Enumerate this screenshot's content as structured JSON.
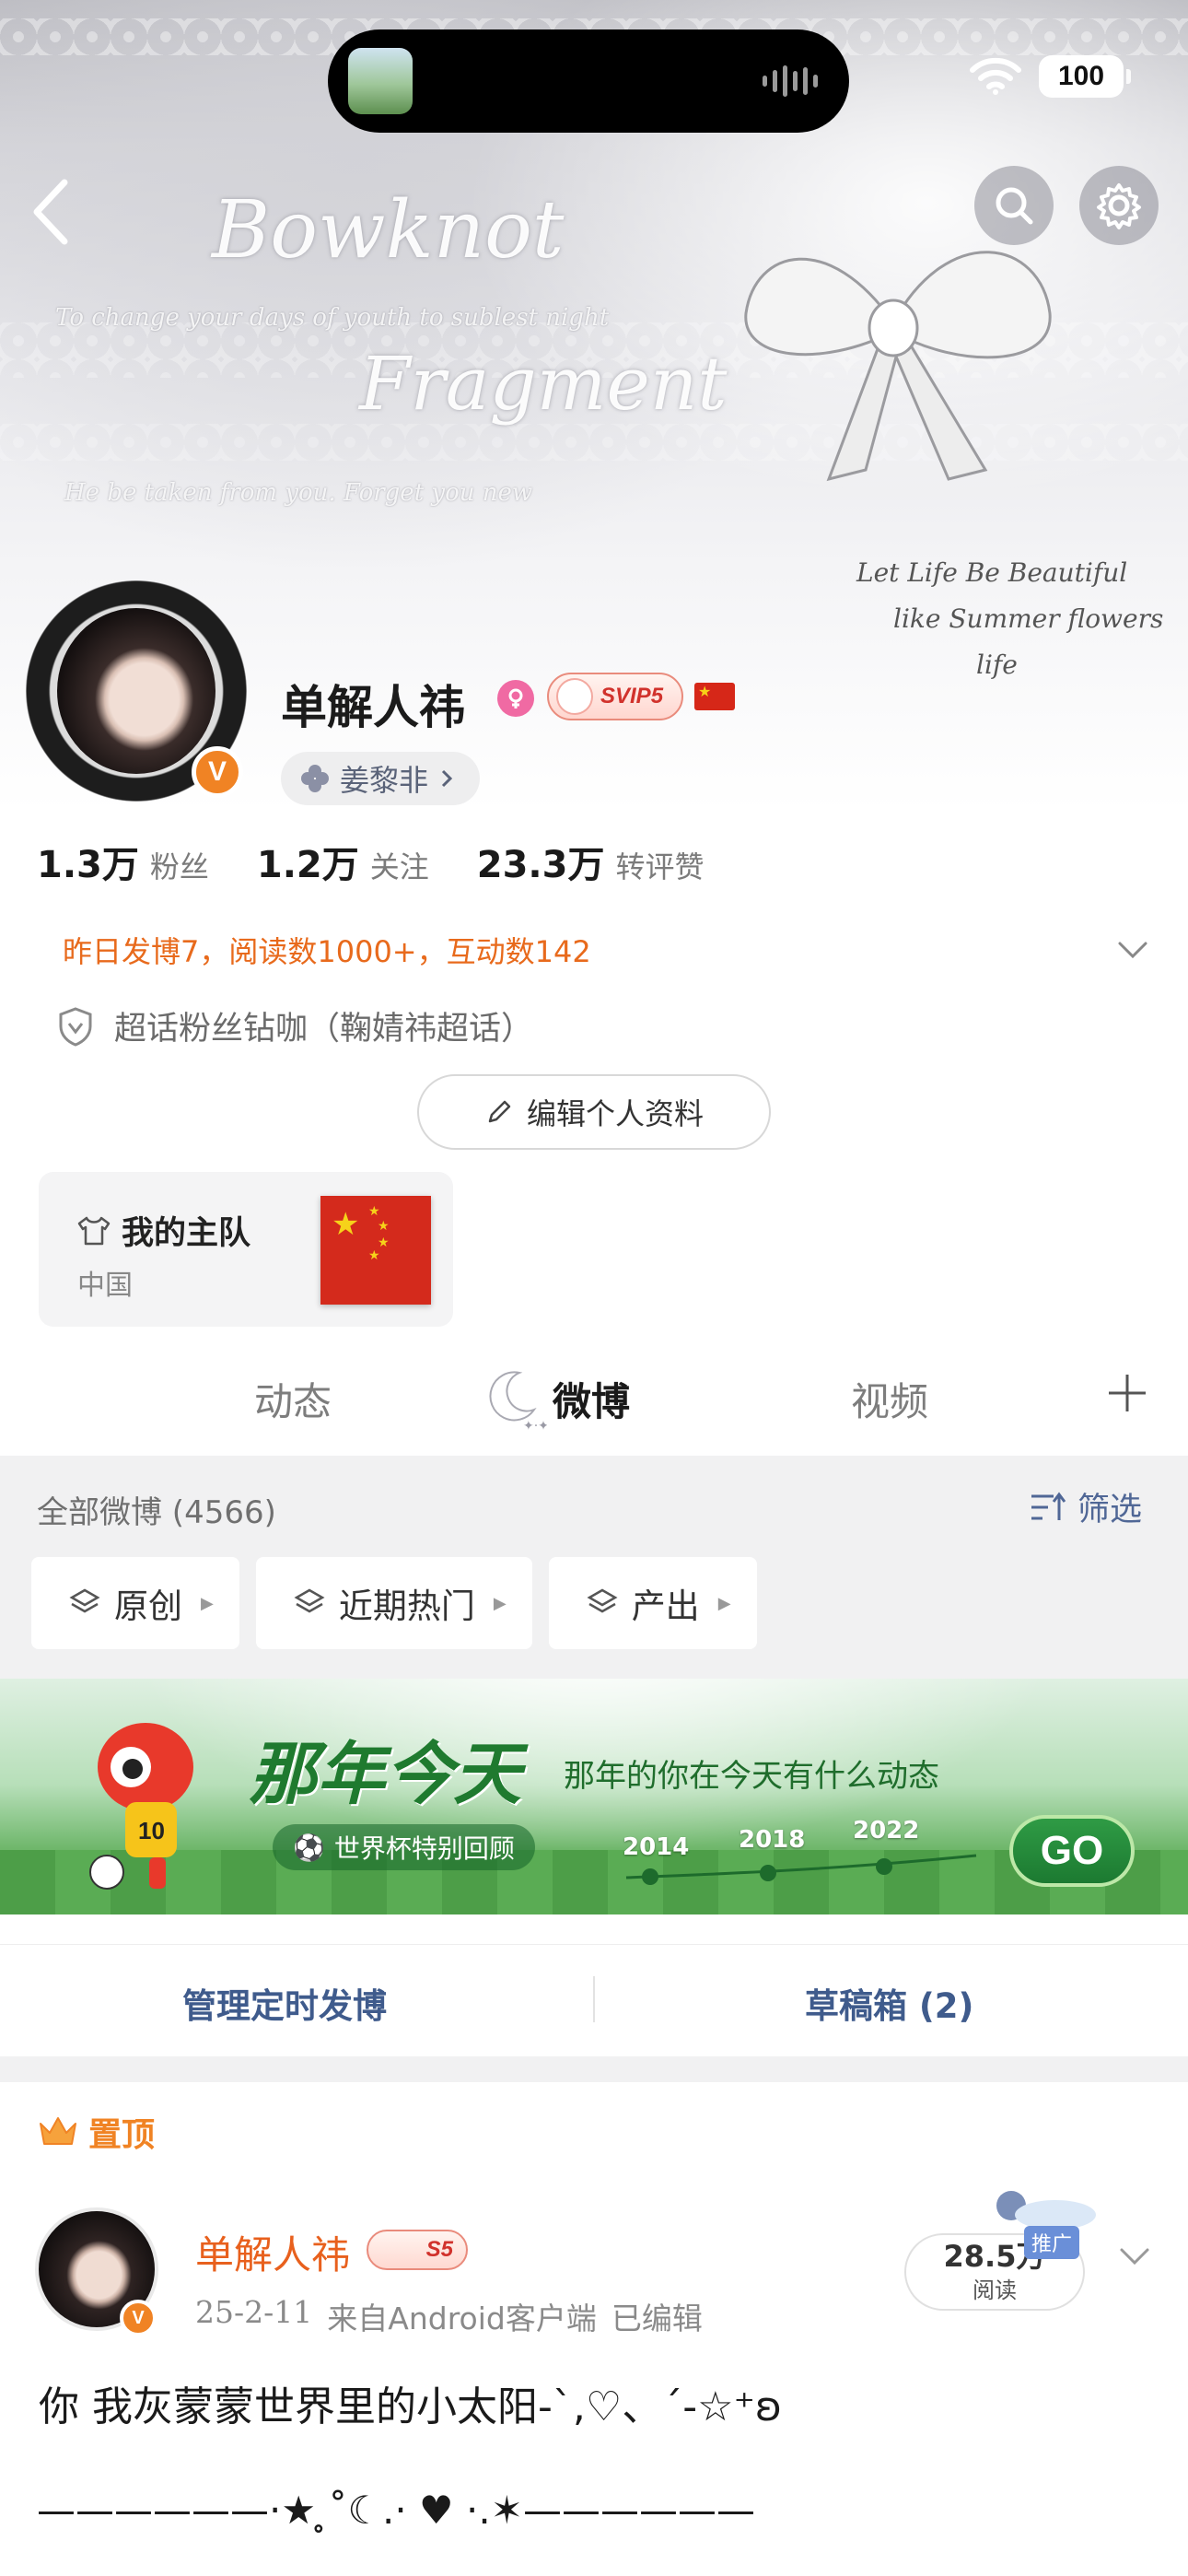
{
  "banner": {
    "script_title_1": "Bowknot",
    "script_title_2": "Fragment",
    "script_line_1": "To change your days of youth to sublest night",
    "script_line_2": "He be taken from you. Forget you new",
    "script_right_1": "Let Life Be Beautiful",
    "script_right_2": "like Summer flowers",
    "script_right_3": "life"
  },
  "status_bar": {
    "battery": "100"
  },
  "profile": {
    "username": "单解人祎",
    "svip_label": "SVIP5",
    "fan_tag": "姜黎非",
    "stats": [
      {
        "num": "1.3万",
        "label": "粉丝"
      },
      {
        "num": "1.2万",
        "label": "关注"
      },
      {
        "num": "23.3万",
        "label": "转评赞"
      }
    ],
    "activity": "昨日发博7，阅读数1000+，互动数142",
    "superchat": "超话粉丝钻咖（鞠婧祎超话）",
    "edit_button": "编辑个人资料",
    "team": {
      "title": "我的主队",
      "country": "中国"
    }
  },
  "tabs": {
    "dynamic": "动态",
    "weibo": "微博",
    "video": "视频"
  },
  "filter": {
    "all_weibo": "全部微博 (4566)",
    "filter_label": "筛选",
    "chips": [
      "原创",
      "近期热门",
      "产出"
    ]
  },
  "promo": {
    "title": "那年今天",
    "subtitle": "那年的你在今天有什么动态",
    "pill": "世界杯特别回顾",
    "years": [
      "2014",
      "2018",
      "2022"
    ],
    "go": "GO",
    "mascot_number": "10"
  },
  "manage": {
    "scheduled": "管理定时发博",
    "drafts": "草稿箱 (2)"
  },
  "post": {
    "pinned_label": "置顶",
    "author": "单解人祎",
    "level_badge": "S5",
    "date": "25-2-11",
    "source": "来自Android客户端",
    "edited": "已编辑",
    "reads_num": "28.5万",
    "reads_label": "阅读",
    "promote": "推广",
    "text": "你 我灰蒙蒙世界里的小太阳-`,♡、´-☆⁺ʚ",
    "divider": "——————·★ ̥˚☾.· ♥ ·.✶——————"
  },
  "colors": {
    "accent_orange": "#f08324",
    "activity_orange": "#e86a1c",
    "link_blue": "#3f5b8c",
    "promo_green": "#1f7a2f"
  }
}
